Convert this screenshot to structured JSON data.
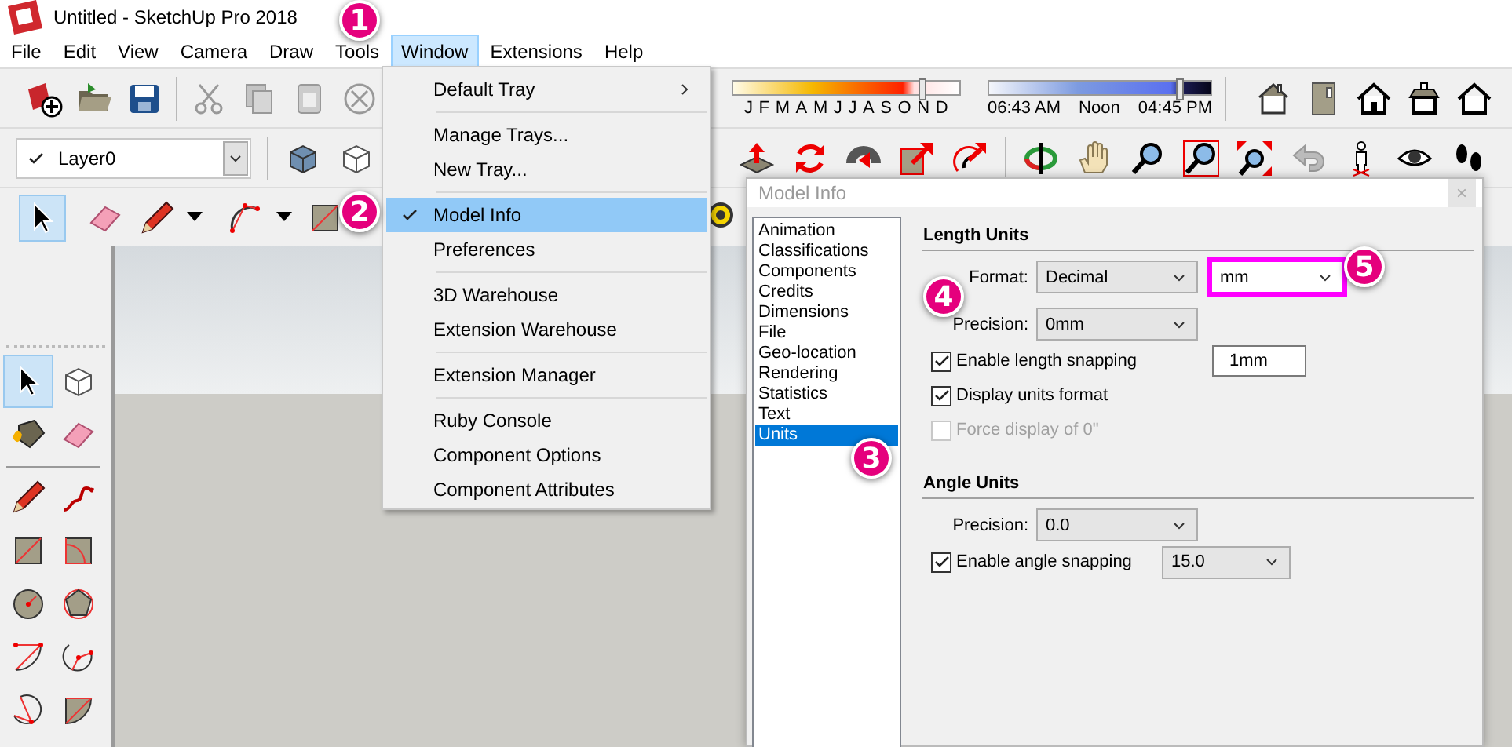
{
  "window": {
    "title": "Untitled - SketchUp Pro 2018"
  },
  "menu_bar": [
    {
      "label": "File",
      "selected": false
    },
    {
      "label": "Edit",
      "selected": false
    },
    {
      "label": "View",
      "selected": false
    },
    {
      "label": "Camera",
      "selected": false
    },
    {
      "label": "Draw",
      "selected": false
    },
    {
      "label": "Tools",
      "selected": false
    },
    {
      "label": "Window",
      "selected": true
    },
    {
      "label": "Extensions",
      "selected": false
    },
    {
      "label": "Help",
      "selected": false
    }
  ],
  "layer_select": {
    "value": "Layer0"
  },
  "shadow_months": {
    "labels": [
      "J",
      "F",
      "M",
      "A",
      "M",
      "J",
      "J",
      "A",
      "S",
      "O",
      "N",
      "D"
    ],
    "level": 0.83
  },
  "shadow_time": {
    "labels": [
      "06:43 AM",
      "Noon",
      "04:45 PM"
    ],
    "level": 0.86
  },
  "window_menu": {
    "groups": [
      [
        {
          "label": "Default Tray",
          "submenu": true,
          "checked": false,
          "selected": false
        }
      ],
      [
        {
          "label": "Manage Trays...",
          "submenu": false,
          "checked": false,
          "selected": false
        },
        {
          "label": "New Tray...",
          "submenu": false,
          "checked": false,
          "selected": false
        }
      ],
      [
        {
          "label": "Model Info",
          "submenu": false,
          "checked": true,
          "selected": true
        },
        {
          "label": "Preferences",
          "submenu": false,
          "checked": false,
          "selected": false
        }
      ],
      [
        {
          "label": "3D Warehouse",
          "submenu": false,
          "checked": false,
          "selected": false
        },
        {
          "label": "Extension Warehouse",
          "submenu": false,
          "checked": false,
          "selected": false
        }
      ],
      [
        {
          "label": "Extension Manager",
          "submenu": false,
          "checked": false,
          "selected": false
        }
      ],
      [
        {
          "label": "Ruby Console",
          "submenu": false,
          "checked": false,
          "selected": false
        },
        {
          "label": "Component Options",
          "submenu": false,
          "checked": false,
          "selected": false
        },
        {
          "label": "Component Attributes",
          "submenu": false,
          "checked": false,
          "selected": false
        }
      ]
    ]
  },
  "dialog": {
    "title": "Model Info",
    "close": "×",
    "categories": [
      {
        "label": "Animation",
        "selected": false
      },
      {
        "label": "Classifications",
        "selected": false
      },
      {
        "label": "Components",
        "selected": false
      },
      {
        "label": "Credits",
        "selected": false
      },
      {
        "label": "Dimensions",
        "selected": false
      },
      {
        "label": "File",
        "selected": false
      },
      {
        "label": "Geo-location",
        "selected": false
      },
      {
        "label": "Rendering",
        "selected": false
      },
      {
        "label": "Statistics",
        "selected": false
      },
      {
        "label": "Text",
        "selected": false
      },
      {
        "label": "Units",
        "selected": true
      }
    ],
    "length_units": {
      "heading": "Length Units",
      "format_label": "Format:",
      "format": "Decimal",
      "unit": {
        "value": "mm",
        "highlighted": true
      },
      "precision_label": "Precision:",
      "precision": "0mm",
      "options": [
        {
          "label": "Enable length snapping",
          "checked": true,
          "disabled": false,
          "input": {
            "kind": "field",
            "value": "1mm"
          }
        },
        {
          "label": "Display units format",
          "checked": true,
          "disabled": false
        },
        {
          "label": "Force display of 0\"",
          "checked": false,
          "disabled": true
        }
      ]
    },
    "angle_units": {
      "heading": "Angle Units",
      "precision_label": "Precision:",
      "precision": "0.0",
      "options": [
        {
          "label": "Enable angle snapping",
          "checked": true,
          "disabled": false,
          "input": {
            "kind": "select",
            "value": "15.0"
          }
        }
      ]
    }
  },
  "callouts": [
    "1",
    "2",
    "3",
    "4",
    "5"
  ]
}
